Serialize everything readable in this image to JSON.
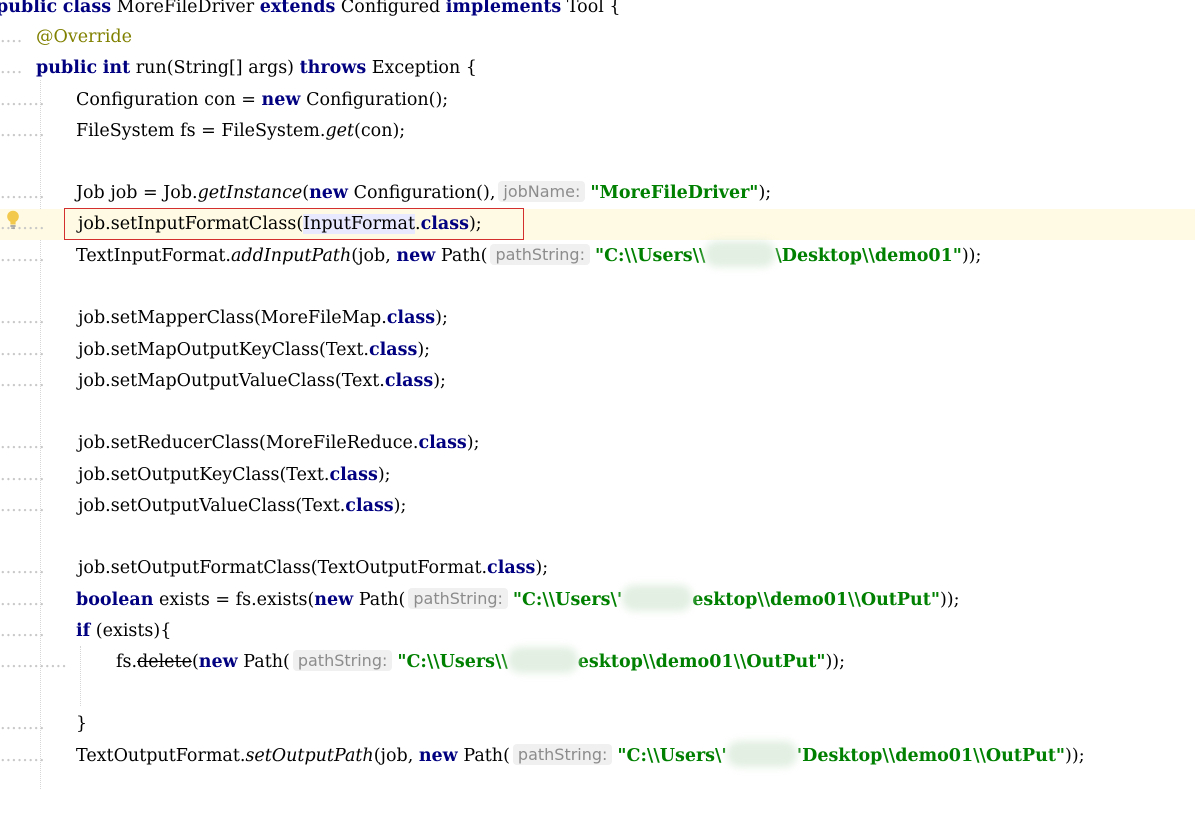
{
  "editor": {
    "l0": {
      "kw_public": "public",
      "kw_class": "class",
      "name": "MoreFileDriver",
      "kw_extends": "extends",
      "base": "Configured",
      "kw_implements": "implements",
      "iface": "Tool",
      "brace": "{"
    },
    "l1": {
      "annotation": "@Override"
    },
    "l2": {
      "kw_public": "public",
      "kw_int": "int",
      "sig": "run(String[] args)",
      "kw_throws": "throws",
      "exc": "Exception {"
    },
    "l3": {
      "a": "Configuration con = ",
      "kw_new": "new",
      "b": "Configuration();"
    },
    "l4": {
      "a": "FileSystem fs = FileSystem.",
      "m": "get",
      "b": "(con);"
    },
    "l5": {
      "a": "Job job = Job.",
      "m": "getInstance",
      "b": "(",
      "kw_new": "new",
      "c": "Configuration(),",
      "hint": "jobName:",
      "str": "\"MoreFileDriver\"",
      "d": ");"
    },
    "l6": {
      "a": "job.setInputFormatClass(",
      "hl": "InputFormat",
      "b": ".",
      "kw_class": "class",
      "c": ");"
    },
    "l7": {
      "a": "TextInputFormat.",
      "m": "addInputPath",
      "b": "(job, ",
      "kw_new": "new",
      "c": "Path(",
      "hint": "pathString:",
      "str1": "\"C:\\\\Users\\\\",
      "str2": "\\Desktop\\\\demo01\"",
      "d": "));"
    },
    "l8": {
      "a": "job.setMapperClass(MoreFileMap.",
      "kw_class": "class",
      "b": ");"
    },
    "l9": {
      "a": "job.setMapOutputKeyClass(Text.",
      "kw_class": "class",
      "b": ");"
    },
    "l10": {
      "a": "job.setMapOutputValueClass(Text.",
      "kw_class": "class",
      "b": ");"
    },
    "l11": {
      "a": "job.setReducerClass(MoreFileReduce.",
      "kw_class": "class",
      "b": ");"
    },
    "l12": {
      "a": "job.setOutputKeyClass(Text.",
      "kw_class": "class",
      "b": ");"
    },
    "l13": {
      "a": "job.setOutputValueClass(Text.",
      "kw_class": "class",
      "b": ");"
    },
    "l14": {
      "a": "job.setOutputFormatClass(TextOutputFormat.",
      "kw_class": "class",
      "b": ");"
    },
    "l15": {
      "kw_boolean": "boolean",
      "a": "exists = fs.exists(",
      "kw_new": "new",
      "b": "Path(",
      "hint": "pathString:",
      "str1": "\"C:\\\\Users\\'",
      "str2": "esktop\\\\demo01\\\\OutPut\"",
      "c": "));"
    },
    "l16": {
      "kw_if": "if",
      "a": "(exists){"
    },
    "l17": {
      "a": "fs.",
      "m": "delete",
      "b": "(",
      "kw_new": "new",
      "c": "Path(",
      "hint": "pathString:",
      "str1": "\"C:\\\\Users\\\\",
      "str2": "esktop\\\\demo01\\\\OutPut\"",
      "d": "));"
    },
    "l18": {
      "a": "}"
    },
    "l19": {
      "a": "TextOutputFormat.",
      "m": "setOutputPath",
      "b": "(job, ",
      "kw_new": "new",
      "c": "Path(",
      "hint": "pathString:",
      "str1": "\"C:\\\\Users\\'",
      "str2": "'Desktop\\\\demo01\\\\OutPut\"",
      "d": "));"
    }
  },
  "icons": {
    "gutter": "lightbulb-icon"
  },
  "colors": {
    "keyword": "#000080",
    "string": "#008000",
    "annotation": "#808000",
    "caret_line": "#fffae3",
    "highlight_box": "#d32f2f"
  }
}
